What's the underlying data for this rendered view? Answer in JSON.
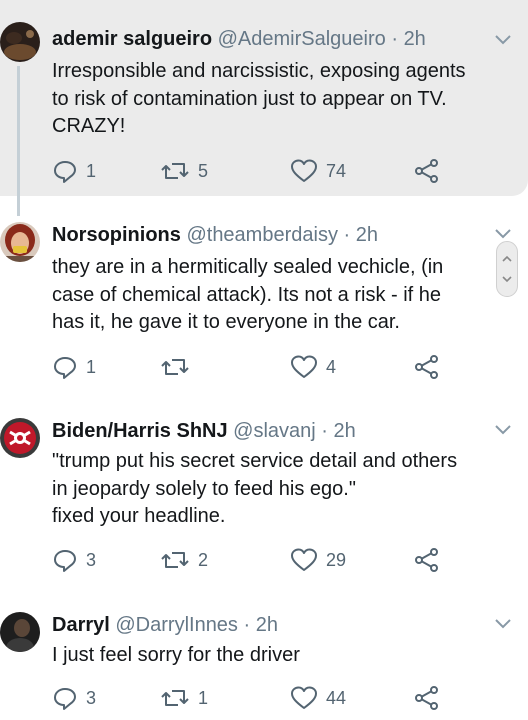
{
  "tweets": [
    {
      "name": "ademir salgueiro",
      "handle": "@AdemirSalgueiro",
      "sep": " · ",
      "time": "2h",
      "text_lines": [
        "Irresponsible and narcissistic, exposing agents",
        "to risk of contamination just to appear on TV.",
        "CRAZY!"
      ],
      "replies": "1",
      "retweets": "5",
      "likes": "74",
      "avatar_icon": "avatar-dark-silhouette"
    },
    {
      "name": "Norsopinions",
      "handle": "@theamberdaisy",
      "sep": " · ",
      "time": "2h",
      "text_lines": [
        "they are in a hermitically sealed vechicle, (in",
        "case of chemical attack). Its not a risk - if he",
        "has it, he gave it to everyone in the car."
      ],
      "replies": "1",
      "retweets": "",
      "likes": "4",
      "avatar_icon": "avatar-person-red-hair"
    },
    {
      "name": "Biden/Harris ShNJ",
      "handle": "@slavanj",
      "sep": " · ",
      "time": "2h",
      "text_lines": [
        "\"trump put his secret service detail and others",
        "in jeopardy solely to feed his ego.\"",
        "fixed your headline."
      ],
      "replies": "3",
      "retweets": "2",
      "likes": "29",
      "avatar_icon": "avatar-red-logo"
    },
    {
      "name": "Darryl",
      "handle": "@DarrylInnes",
      "sep": " · ",
      "time": "2h",
      "text_lines": [
        "I just feel sorry for the driver"
      ],
      "replies": "3",
      "retweets": "1",
      "likes": "44",
      "avatar_icon": "avatar-dark-person"
    }
  ],
  "colors": {
    "name": "#14171a",
    "meta": "#657786",
    "icon": "#536471",
    "highlight_bg": "#ebebeb",
    "thread_line": "#c4cfd6"
  }
}
